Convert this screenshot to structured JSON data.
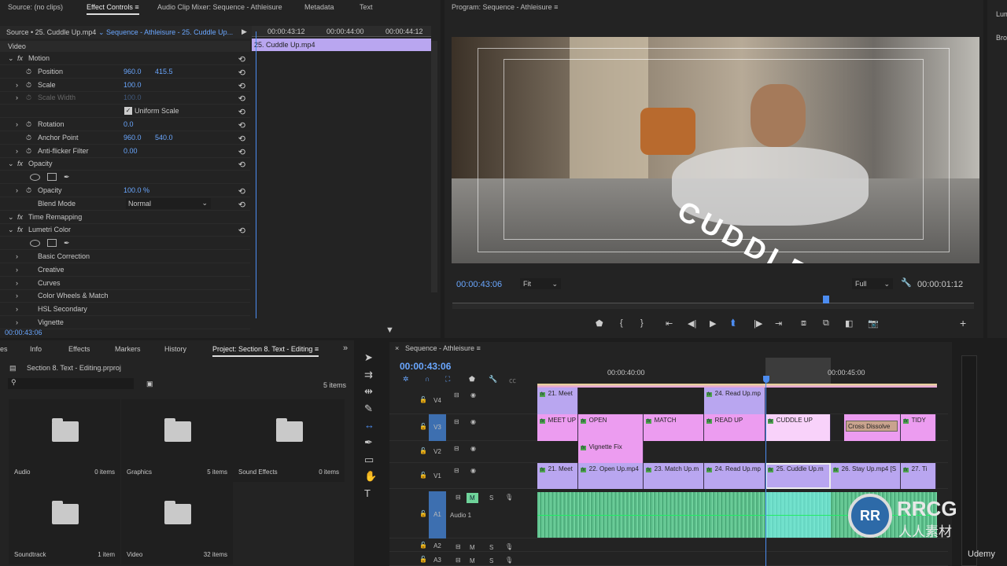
{
  "top_tabs": [
    "Source: (no clips)",
    "Effect Controls",
    "Audio Clip Mixer: Sequence - Athleisure",
    "Metadata",
    "Text"
  ],
  "effect_controls": {
    "source": "Source • 25. Cuddle Up.mp4",
    "sequence": "Sequence - Athleisure - 25. Cuddle Up...",
    "ruler": [
      "00:00:43:12",
      "00:00:44:00",
      "00:00:44:12"
    ],
    "clip": "25. Cuddle Up.mp4",
    "section": "Video",
    "rows": [
      {
        "label": "Motion",
        "fx": true
      },
      {
        "label": "Position",
        "v1": "960.0",
        "v2": "415.5"
      },
      {
        "label": "Scale",
        "v1": "100.0"
      },
      {
        "label": "Scale Width",
        "v1": "100.0",
        "disabled": true
      },
      {
        "label": "Uniform Scale",
        "checkbox": true
      },
      {
        "label": "Rotation",
        "v1": "0.0"
      },
      {
        "label": "Anchor Point",
        "v1": "960.0",
        "v2": "540.0"
      },
      {
        "label": "Anti-flicker Filter",
        "v1": "0.00"
      },
      {
        "label": "Opacity",
        "fx": true
      },
      {
        "label": "",
        "masks": true
      },
      {
        "label": "Opacity",
        "v1": "100.0 %"
      },
      {
        "label": "Blend Mode",
        "select": "Normal"
      },
      {
        "label": "Time Remapping",
        "fx": true
      },
      {
        "label": "Lumetri Color",
        "fx": true
      },
      {
        "label": "",
        "masks": true
      },
      {
        "label": "Basic Correction"
      },
      {
        "label": "Creative"
      },
      {
        "label": "Curves"
      },
      {
        "label": "Color Wheels & Match"
      },
      {
        "label": "HSL Secondary"
      },
      {
        "label": "Vignette"
      }
    ],
    "timecode": "00:00:43:06"
  },
  "program": {
    "title": "Program: Sequence - Athleisure",
    "overlay_text": "CUDDLE /",
    "timecode": "00:00:43:06",
    "zoom": "Fit",
    "quality": "Full",
    "duration": "00:00:01:12"
  },
  "right_panel": [
    "Lum",
    "Bro"
  ],
  "project": {
    "tabs": [
      "es",
      "Info",
      "Effects",
      "Markers",
      "History",
      "Project: Section 8. Text - Editing"
    ],
    "file": "Section 8. Text - Editing.prproj",
    "count": "5 items",
    "search_placeholder": "",
    "bins": [
      {
        "name": "Audio",
        "count": "0 items"
      },
      {
        "name": "Graphics",
        "count": "5 items"
      },
      {
        "name": "Sound Effects",
        "count": "0 items"
      },
      {
        "name": "Soundtrack",
        "count": "1 item"
      },
      {
        "name": "Video",
        "count": "32 items"
      }
    ]
  },
  "timeline": {
    "title": "Sequence - Athleisure",
    "timecode": "00:00:43:06",
    "ruler": [
      "00:00:40:00",
      "00:00:45:00"
    ],
    "tracks": [
      "V4",
      "V3",
      "V2",
      "V1",
      "A1",
      "A2",
      "A3"
    ],
    "audio_name": "Audio 1",
    "mute": "M",
    "solo": "S",
    "v4": [
      "21. Meet",
      "24. Read Up.mp"
    ],
    "v3": [
      "MEET UP",
      "OPEN",
      "MATCH",
      "READ UP",
      "CUDDLE UP",
      "Cross Dissolve",
      "TIDY"
    ],
    "v2": [
      "Vignette Fix"
    ],
    "v1": [
      "21. Meet",
      "22. Open Up.mp4",
      "23. Match Up.m",
      "24. Read Up.mp",
      "25. Cuddle Up.m",
      "26. Stay Up.mp4 [S",
      "27. Ti"
    ]
  },
  "watermark": {
    "brand": "RRCG",
    "sub": "人人素材",
    "udemy": "Udemy"
  }
}
